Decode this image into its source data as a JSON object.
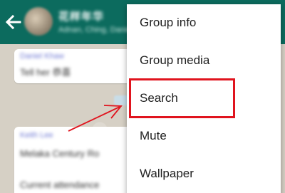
{
  "header": {
    "title": "花样年华",
    "subtitle": "Adnan, Ching, Daniel, ...",
    "back_icon": "arrow-left-icon",
    "bar_color": "#0c6b5e"
  },
  "chat": {
    "messages": [
      {
        "sender": "Daniel Khaw",
        "text": "Tell her 恭喜"
      },
      {
        "sender": "Keith Lee",
        "text": "Melaka Century Ro",
        "extra": "Current attendance"
      }
    ]
  },
  "menu": {
    "items": [
      {
        "label": "Group info"
      },
      {
        "label": "Group media"
      },
      {
        "label": "Search"
      },
      {
        "label": "Mute"
      },
      {
        "label": "Wallpaper"
      }
    ],
    "highlight_color": "#e0141e",
    "highlighted_item": "Search"
  },
  "annotation": {
    "arrow_icon": "red-pointer-arrow-icon",
    "arrow_color": "#e0141e"
  }
}
